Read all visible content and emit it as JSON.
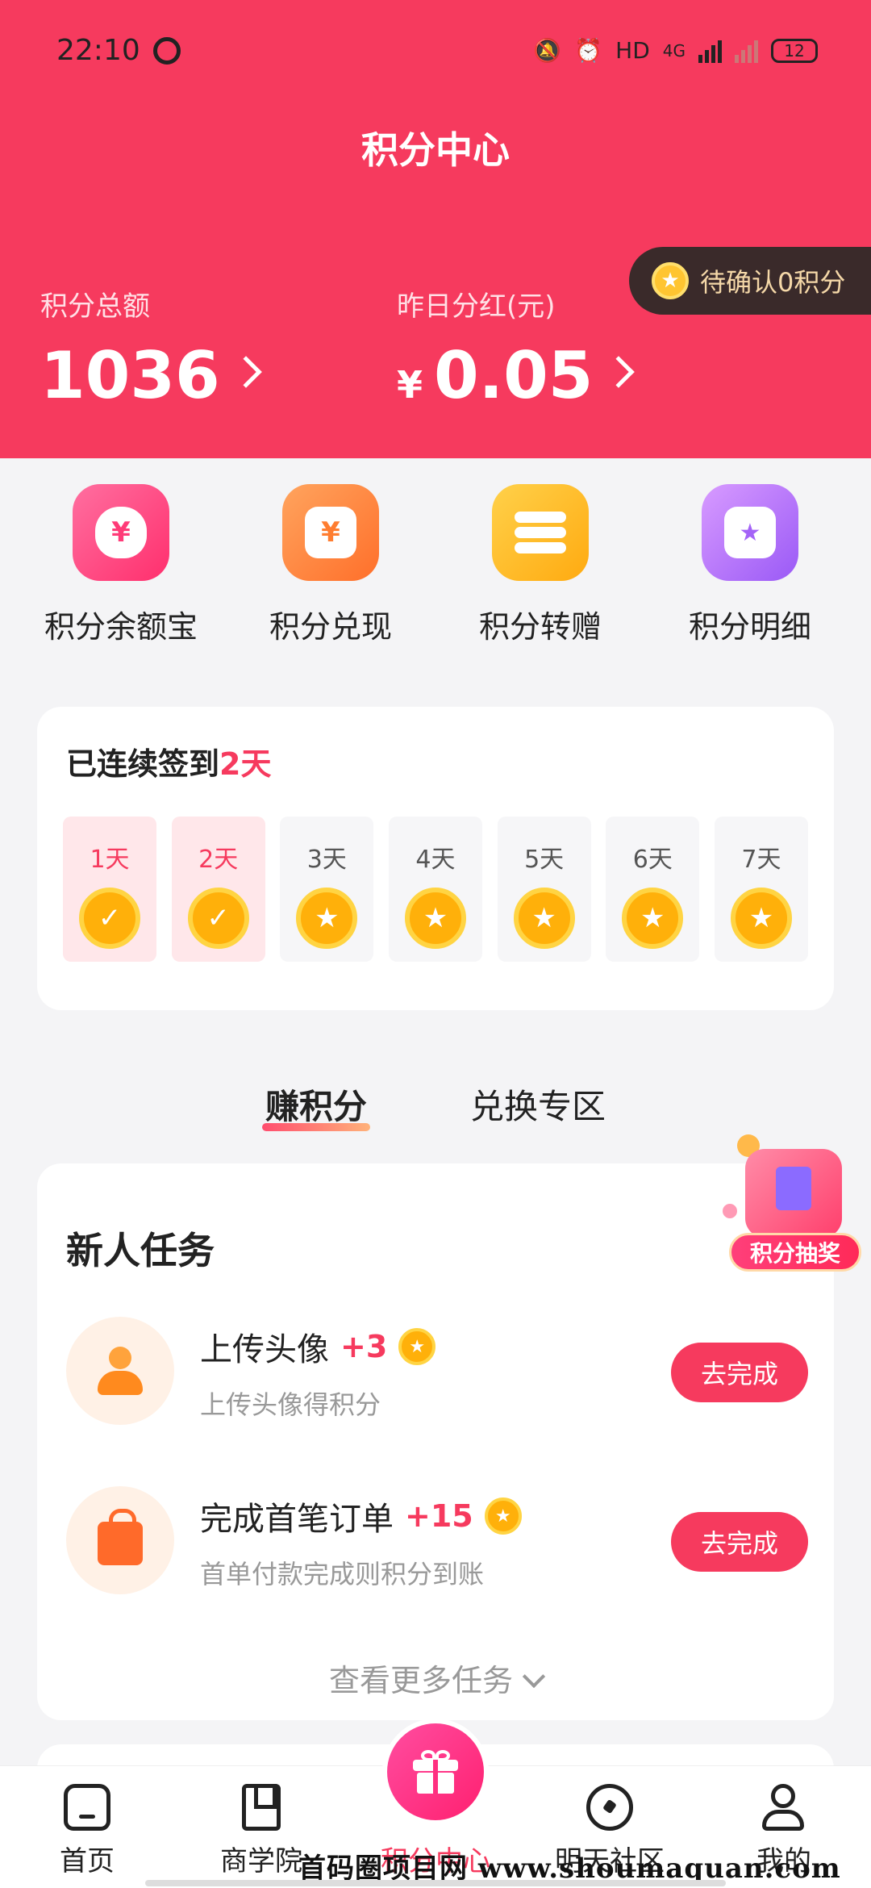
{
  "status_bar": {
    "time": "22:10",
    "hd": "HD",
    "net": "4G",
    "battery": "12"
  },
  "header": {
    "title": "积分中心",
    "pending": "待确认0积分",
    "total_label": "积分总额",
    "total_value": "1036",
    "dividend_label": "昨日分红(元)",
    "currency": "¥",
    "dividend_value": "0.05",
    "colors": {
      "brand": "#f63a5e"
    }
  },
  "quick_menu": [
    {
      "label": "积分余额宝",
      "icon": "money-bag-icon",
      "glyph": "¥"
    },
    {
      "label": "积分兑现",
      "icon": "cash-card-icon",
      "glyph": "¥"
    },
    {
      "label": "积分转赠",
      "icon": "coin-stack-icon",
      "glyph": ""
    },
    {
      "label": "积分明细",
      "icon": "ledger-icon",
      "glyph": "★"
    }
  ],
  "checkin": {
    "title_prefix": "已连续签到",
    "streak": "2天",
    "days": [
      {
        "label": "1天",
        "done": true
      },
      {
        "label": "2天",
        "done": true
      },
      {
        "label": "3天",
        "done": false
      },
      {
        "label": "4天",
        "done": false
      },
      {
        "label": "5天",
        "done": false
      },
      {
        "label": "6天",
        "done": false
      },
      {
        "label": "7天",
        "done": false
      }
    ]
  },
  "tabs": [
    {
      "label": "赚积分",
      "active": true
    },
    {
      "label": "兑换专区",
      "active": false
    }
  ],
  "lottery": {
    "label": "积分抽奖"
  },
  "tasks": {
    "title": "新人任务",
    "items": [
      {
        "name": "上传头像",
        "points": "+3",
        "desc": "上传头像得积分",
        "button": "去完成",
        "icon": "person-icon"
      },
      {
        "name": "完成首笔订单",
        "points": "+15",
        "desc": "首单付款完成则积分到账",
        "button": "去完成",
        "icon": "shopping-bag-icon"
      }
    ],
    "more": "查看更多任务"
  },
  "bottom_nav": [
    {
      "label": "首页",
      "icon": "home-icon",
      "active": false
    },
    {
      "label": "商学院",
      "icon": "book-icon",
      "active": false
    },
    {
      "label": "积分中心",
      "icon": "gift-icon",
      "active": true
    },
    {
      "label": "明天社区",
      "icon": "compass-icon",
      "active": false
    },
    {
      "label": "我的",
      "icon": "user-icon",
      "active": false
    }
  ],
  "watermark": "首码圈项目网 www.shoumaquan.com"
}
